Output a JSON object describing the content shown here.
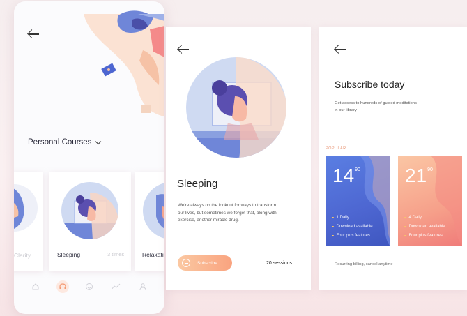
{
  "phone": {
    "dropdown_label": "Personal Courses",
    "mini_cards": [
      {
        "label": "Clarity"
      },
      {
        "label": "Sleeping",
        "right_label": "3 times"
      },
      {
        "label": "Relaxation"
      }
    ],
    "tabs": [
      "home-icon",
      "headphones-icon",
      "smile-icon",
      "stats-icon",
      "profile-icon"
    ]
  },
  "detail": {
    "title": "Sleeping",
    "description": [
      "We're always on the lookout for ways to transform",
      "our lives, but sometimes we forget that, along with",
      "exercise, another miracle drug."
    ],
    "subscribe_label": "Subscribe",
    "sessions": "20 sessions"
  },
  "subscribe": {
    "title": "Subscribe today",
    "subtitle": [
      "Get access to hundreds of guided meditations",
      "in our library"
    ],
    "popular_label": "POPULAR",
    "plans": [
      {
        "price": "14",
        "cents": "90",
        "features": [
          "1 Daily",
          "Download available",
          "Four plus features"
        ]
      },
      {
        "price": "21",
        "cents": "90",
        "features": [
          "4 Daily",
          "Download available",
          "Four plus features"
        ]
      }
    ],
    "footer": "Recurring billing, cancel anytime"
  },
  "colors": {
    "accent_orange": "#f49a74",
    "accent_blue": "#4d66d1",
    "accent_peach": "#f6b38d"
  }
}
